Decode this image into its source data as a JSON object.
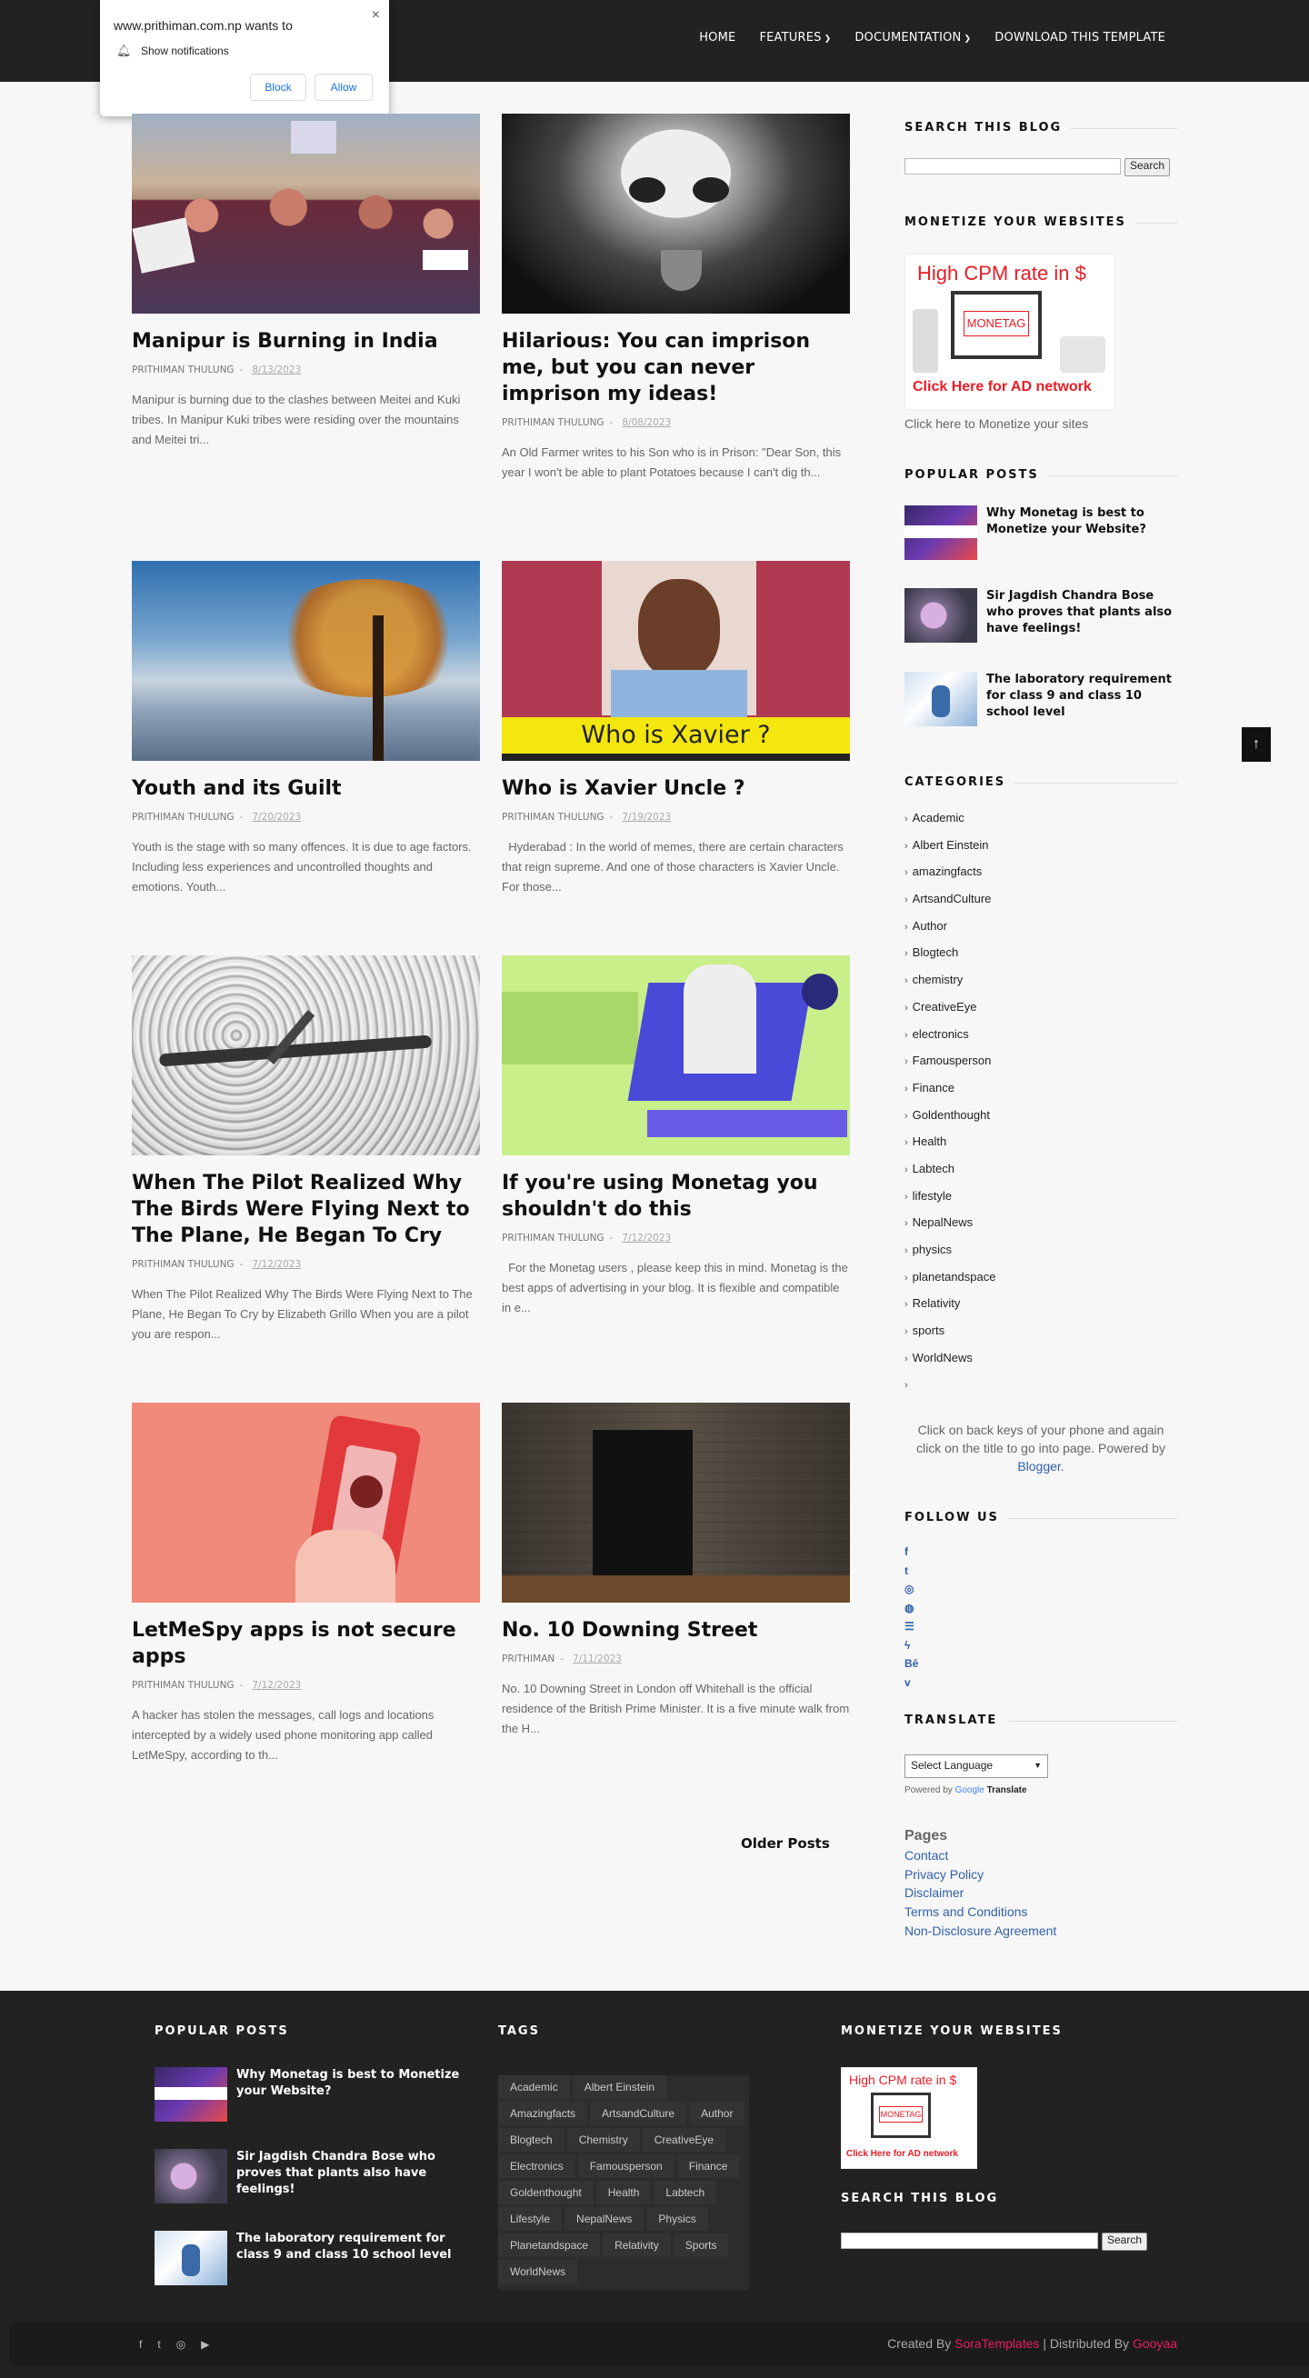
{
  "header": {
    "nav": [
      {
        "label": "HOME",
        "dropdown": false
      },
      {
        "label": "FEATURES",
        "dropdown": true
      },
      {
        "label": "DOCUMENTATION",
        "dropdown": true
      },
      {
        "label": "DOWNLOAD THIS TEMPLATE",
        "dropdown": false
      }
    ]
  },
  "notification": {
    "site": "www.prithiman.com.np wants to",
    "message": "Show notifications",
    "block_label": "Block",
    "allow_label": "Allow",
    "close_label": "×"
  },
  "posts": [
    {
      "title": "Manipur is Burning in India",
      "author": "PRITHIMAN THULUNG",
      "date": "8/13/2023",
      "snippet": "Manipur is burning due to the clashes between Meitei and Kuki tribes. In Manipur Kuki tribes were residing over the mountains and Meitei tri..."
    },
    {
      "title": "Hilarious: You can imprison me, but you can never imprison my ideas!",
      "author": "PRITHIMAN THULUNG",
      "date": "8/08/2023",
      "snippet": "An Old Farmer writes to his Son who is in Prison: \"Dear Son, this year I won't be able to plant Potatoes because I can't dig th..."
    },
    {
      "title": "Youth and its Guilt",
      "author": "PRITHIMAN THULUNG",
      "date": "7/20/2023",
      "snippet": "Youth is the stage with so many offences. It is due to age factors. Including less experiences and uncontrolled thoughts and emotions. Youth..."
    },
    {
      "title": "Who is Xavier Uncle ?",
      "author": "PRITHIMAN THULUNG",
      "date": "7/19/2023",
      "snippet": "  Hyderabad : In the world of memes, there are certain characters that reign supreme. And one of those characters is Xavier Uncle. For those...",
      "image_caption": "Who is Xavier ?"
    },
    {
      "title": "When The Pilot Realized Why The Birds Were Flying Next to The Plane, He Began To Cry",
      "author": "PRITHIMAN THULUNG",
      "date": "7/12/2023",
      "snippet": "When The Pilot Realized Why The Birds Were Flying Next to The Plane, He Began To Cry by Elizabeth Grillo When you are a pilot you are respon..."
    },
    {
      "title": "If you're using Monetag you shouldn't do this",
      "author": "PRITHIMAN THULUNG",
      "date": "7/12/2023",
      "snippet": "  For the Monetag users , please keep this in mind. Monetag is the best apps of advertising in your blog. It is flexible and compatible in e..."
    },
    {
      "title": "LetMeSpy apps is not secure apps",
      "author": "PRITHIMAN THULUNG",
      "date": "7/12/2023",
      "snippet": "A hacker has stolen the messages, call logs and locations intercepted by a widely used phone monitoring app called LetMeSpy, according to th..."
    },
    {
      "title": "No. 10 Downing Street",
      "author": "PRITHIMAN",
      "date": "7/11/2023",
      "snippet": "No. 10 Downing Street in London off Whitehall is the official residence of the British Prime Minister. It is a five minute walk from the H..."
    }
  ],
  "older_posts_label": "Older Posts",
  "sidebar": {
    "search_title": "SEARCH THIS BLOG",
    "search_button": "Search",
    "monetize_title": "MONETIZE YOUR WEBSITES",
    "ad": {
      "top": "High CPM rate in $",
      "brand": "MONETAG",
      "bottom": "Click Here for AD network"
    },
    "monetize_caption": "Click here to Monetize your sites",
    "popular_title": "POPULAR POSTS",
    "popular": [
      {
        "title": "Why Monetag is best to Monetize your Website?"
      },
      {
        "title": "Sir Jagdish Chandra Bose who proves that plants also have feelings!"
      },
      {
        "title": "The laboratory requirement for class 9 and class 10 school level"
      }
    ],
    "categories_title": "CATEGORIES",
    "categories": [
      "Academic",
      "Albert Einstein",
      "amazingfacts",
      "ArtsandCulture",
      "Author",
      "Blogtech",
      "chemistry",
      "CreativeEye",
      "electronics",
      "Famousperson",
      "Finance",
      "Goldenthought",
      "Health",
      "Labtech",
      "lifestyle",
      "NepalNews",
      "physics",
      "planetandspace",
      "Relativity",
      "sports",
      "WorldNews",
      ""
    ],
    "note_text": "Click on back keys of your phone and again click on the title to go into page. Powered by ",
    "note_link": "Blogger",
    "note_end": ".",
    "follow_title": "FOLLOW US",
    "follow_icons": [
      "f",
      "t",
      "◎",
      "◍",
      "☰",
      "ϟ",
      "Bē",
      "v"
    ],
    "translate_title": "TRANSLATE",
    "language_select": "Select Language",
    "powered_by": "Powered by",
    "google": "Google",
    "translate_word": "Translate",
    "pages_title": "Pages",
    "pages": [
      "Contact",
      "Privacy Policy",
      "Disclaimer",
      "Terms and Conditions",
      "Non-Disclosure Agreement"
    ]
  },
  "scroll_top": "↑",
  "footer": {
    "popular_title": "POPULAR POSTS",
    "popular": [
      {
        "title": "Why Monetag is best to Monetize your Website?"
      },
      {
        "title": "Sir Jagdish Chandra Bose who proves that plants also have feelings!"
      },
      {
        "title": "The laboratory requirement for class 9 and class 10 school level"
      }
    ],
    "tags_title": "TAGS",
    "tags": [
      "Academic",
      "Albert Einstein",
      "Amazingfacts",
      "ArtsandCulture",
      "Author",
      "Blogtech",
      "Chemistry",
      "CreativeEye",
      "Electronics",
      "Famousperson",
      "Finance",
      "Goldenthought",
      "Health",
      "Labtech",
      "Lifestyle",
      "NepalNews",
      "Physics",
      "Planetandspace",
      "Relativity",
      "Sports",
      "WorldNews"
    ],
    "monetize_title": "MONETIZE YOUR WEBSITES",
    "search_title": "SEARCH THIS BLOG",
    "search_button": "Search",
    "created_by": "Created By ",
    "created_link": "SoraTemplates",
    "distributed_by": " | Distributed By ",
    "distributed_link": "Gooyaa"
  },
  "colors": {
    "header_bg": "#222222",
    "accent": "#3260a8",
    "ad_red": "#e91c25",
    "credit_pink": "#e91e63"
  }
}
